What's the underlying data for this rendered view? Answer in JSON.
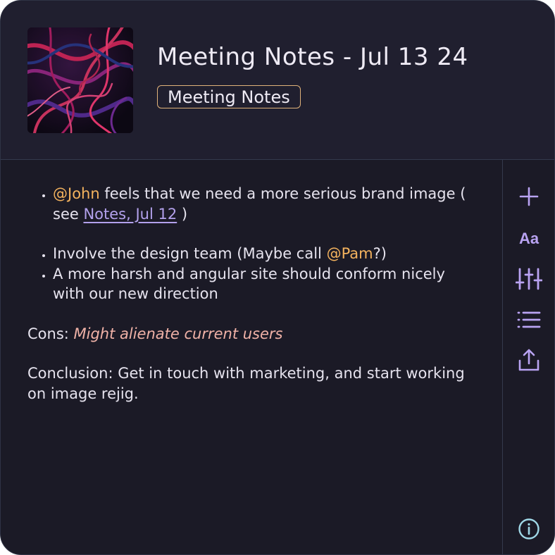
{
  "header": {
    "title": "Meeting Notes - Jul 13 24",
    "tag": "Meeting Notes"
  },
  "notes": {
    "bullet1": {
      "mention": "@John",
      "text": " feels that we need a more serious brand image ( see ",
      "link": "Notes, Jul 12",
      "after": " )"
    },
    "bullet2": {
      "text": "Involve the design team (Maybe call ",
      "mention": "@Pam",
      "after": "?)"
    },
    "bullet3": {
      "text": "A more harsh and angular site should conform nicely with our new direction"
    },
    "cons": {
      "label": "Cons: ",
      "text": "Might alienate current users"
    },
    "conclusion": "Conclusion: Get in touch with marketing, and start working on image rejig."
  },
  "toolbar": {
    "font_label": "Aa",
    "icons": [
      "plus-icon",
      "text-format-icon",
      "sliders-icon",
      "list-icon",
      "share-icon",
      "info-icon"
    ]
  },
  "colors": {
    "background": "#1b1a26",
    "header": "#201f2f",
    "accent": "#b9a3f2",
    "mention": "#f4b35e",
    "tag_border": "#e0b27a",
    "info": "#9fd7e6"
  }
}
